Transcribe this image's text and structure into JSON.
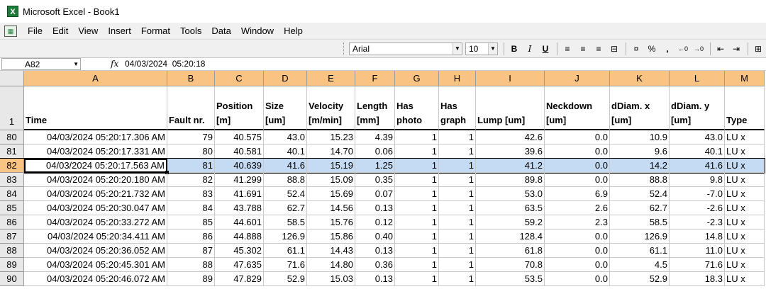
{
  "window": {
    "title": "Microsoft Excel - Book1",
    "app_icon": "excel-icon"
  },
  "menu": [
    "File",
    "Edit",
    "View",
    "Insert",
    "Format",
    "Tools",
    "Data",
    "Window",
    "Help"
  ],
  "toolbar": {
    "font": "Arial",
    "size": "10",
    "bold": "B",
    "italic": "I",
    "underline": "U",
    "percent": "%",
    "comma": ","
  },
  "formula_bar": {
    "name_box": "A82",
    "fx": "fx",
    "formula": "04/03/2024  05:20:18"
  },
  "columns": [
    "A",
    "B",
    "C",
    "D",
    "E",
    "F",
    "G",
    "H",
    "I",
    "J",
    "K",
    "L",
    "M"
  ],
  "header_row": {
    "row": "1",
    "labels": [
      [
        "",
        "Time"
      ],
      [
        "",
        "Fault nr."
      ],
      [
        "Position",
        "[m]"
      ],
      [
        "Size",
        "[um]"
      ],
      [
        "Velocity",
        "[m/min]"
      ],
      [
        "Length",
        "[mm]"
      ],
      [
        "Has",
        "photo"
      ],
      [
        "Has",
        "graph"
      ],
      [
        "",
        "Lump [um]"
      ],
      [
        "Neckdown",
        "[um]"
      ],
      [
        "dDiam. x",
        "[um]"
      ],
      [
        "dDiam. y",
        "[um]"
      ],
      [
        "",
        "Type"
      ]
    ]
  },
  "selected_row": "82",
  "rows": [
    {
      "row": "80",
      "cells": [
        "04/03/2024 05:20:17.306 AM",
        "79",
        "40.575",
        "43.0",
        "15.23",
        "4.39",
        "1",
        "1",
        "42.6",
        "0.0",
        "10.9",
        "43.0",
        "LU x"
      ]
    },
    {
      "row": "81",
      "cells": [
        "04/03/2024 05:20:17.331 AM",
        "80",
        "40.581",
        "40.1",
        "14.70",
        "0.06",
        "1",
        "1",
        "39.6",
        "0.0",
        "9.6",
        "40.1",
        "LU x"
      ]
    },
    {
      "row": "82",
      "cells": [
        "04/03/2024 05:20:17.563 AM",
        "81",
        "40.639",
        "41.6",
        "15.19",
        "1.25",
        "1",
        "1",
        "41.2",
        "0.0",
        "14.2",
        "41.6",
        "LU x"
      ]
    },
    {
      "row": "83",
      "cells": [
        "04/03/2024 05:20:20.180 AM",
        "82",
        "41.299",
        "88.8",
        "15.09",
        "0.35",
        "1",
        "1",
        "89.8",
        "0.0",
        "88.8",
        "9.8",
        "LU x"
      ]
    },
    {
      "row": "84",
      "cells": [
        "04/03/2024 05:20:21.732 AM",
        "83",
        "41.691",
        "52.4",
        "15.69",
        "0.07",
        "1",
        "1",
        "53.0",
        "6.9",
        "52.4",
        "-7.0",
        "LU x"
      ]
    },
    {
      "row": "85",
      "cells": [
        "04/03/2024 05:20:30.047 AM",
        "84",
        "43.788",
        "62.7",
        "14.56",
        "0.13",
        "1",
        "1",
        "63.5",
        "2.6",
        "62.7",
        "-2.6",
        "LU x"
      ]
    },
    {
      "row": "86",
      "cells": [
        "04/03/2024 05:20:33.272 AM",
        "85",
        "44.601",
        "58.5",
        "15.76",
        "0.12",
        "1",
        "1",
        "59.2",
        "2.3",
        "58.5",
        "-2.3",
        "LU x"
      ]
    },
    {
      "row": "87",
      "cells": [
        "04/03/2024 05:20:34.411 AM",
        "86",
        "44.888",
        "126.9",
        "15.86",
        "0.40",
        "1",
        "1",
        "128.4",
        "0.0",
        "126.9",
        "14.8",
        "LU x"
      ]
    },
    {
      "row": "88",
      "cells": [
        "04/03/2024 05:20:36.052 AM",
        "87",
        "45.302",
        "61.1",
        "14.43",
        "0.13",
        "1",
        "1",
        "61.8",
        "0.0",
        "61.1",
        "11.0",
        "LU x"
      ]
    },
    {
      "row": "89",
      "cells": [
        "04/03/2024 05:20:45.301 AM",
        "88",
        "47.635",
        "71.6",
        "14.80",
        "0.36",
        "1",
        "1",
        "70.8",
        "0.0",
        "4.5",
        "71.6",
        "LU x"
      ]
    },
    {
      "row": "90",
      "cells": [
        "04/03/2024 05:20:46.072 AM",
        "89",
        "47.829",
        "52.9",
        "15.03",
        "0.13",
        "1",
        "1",
        "53.5",
        "0.0",
        "52.9",
        "18.3",
        "LU x"
      ]
    }
  ]
}
